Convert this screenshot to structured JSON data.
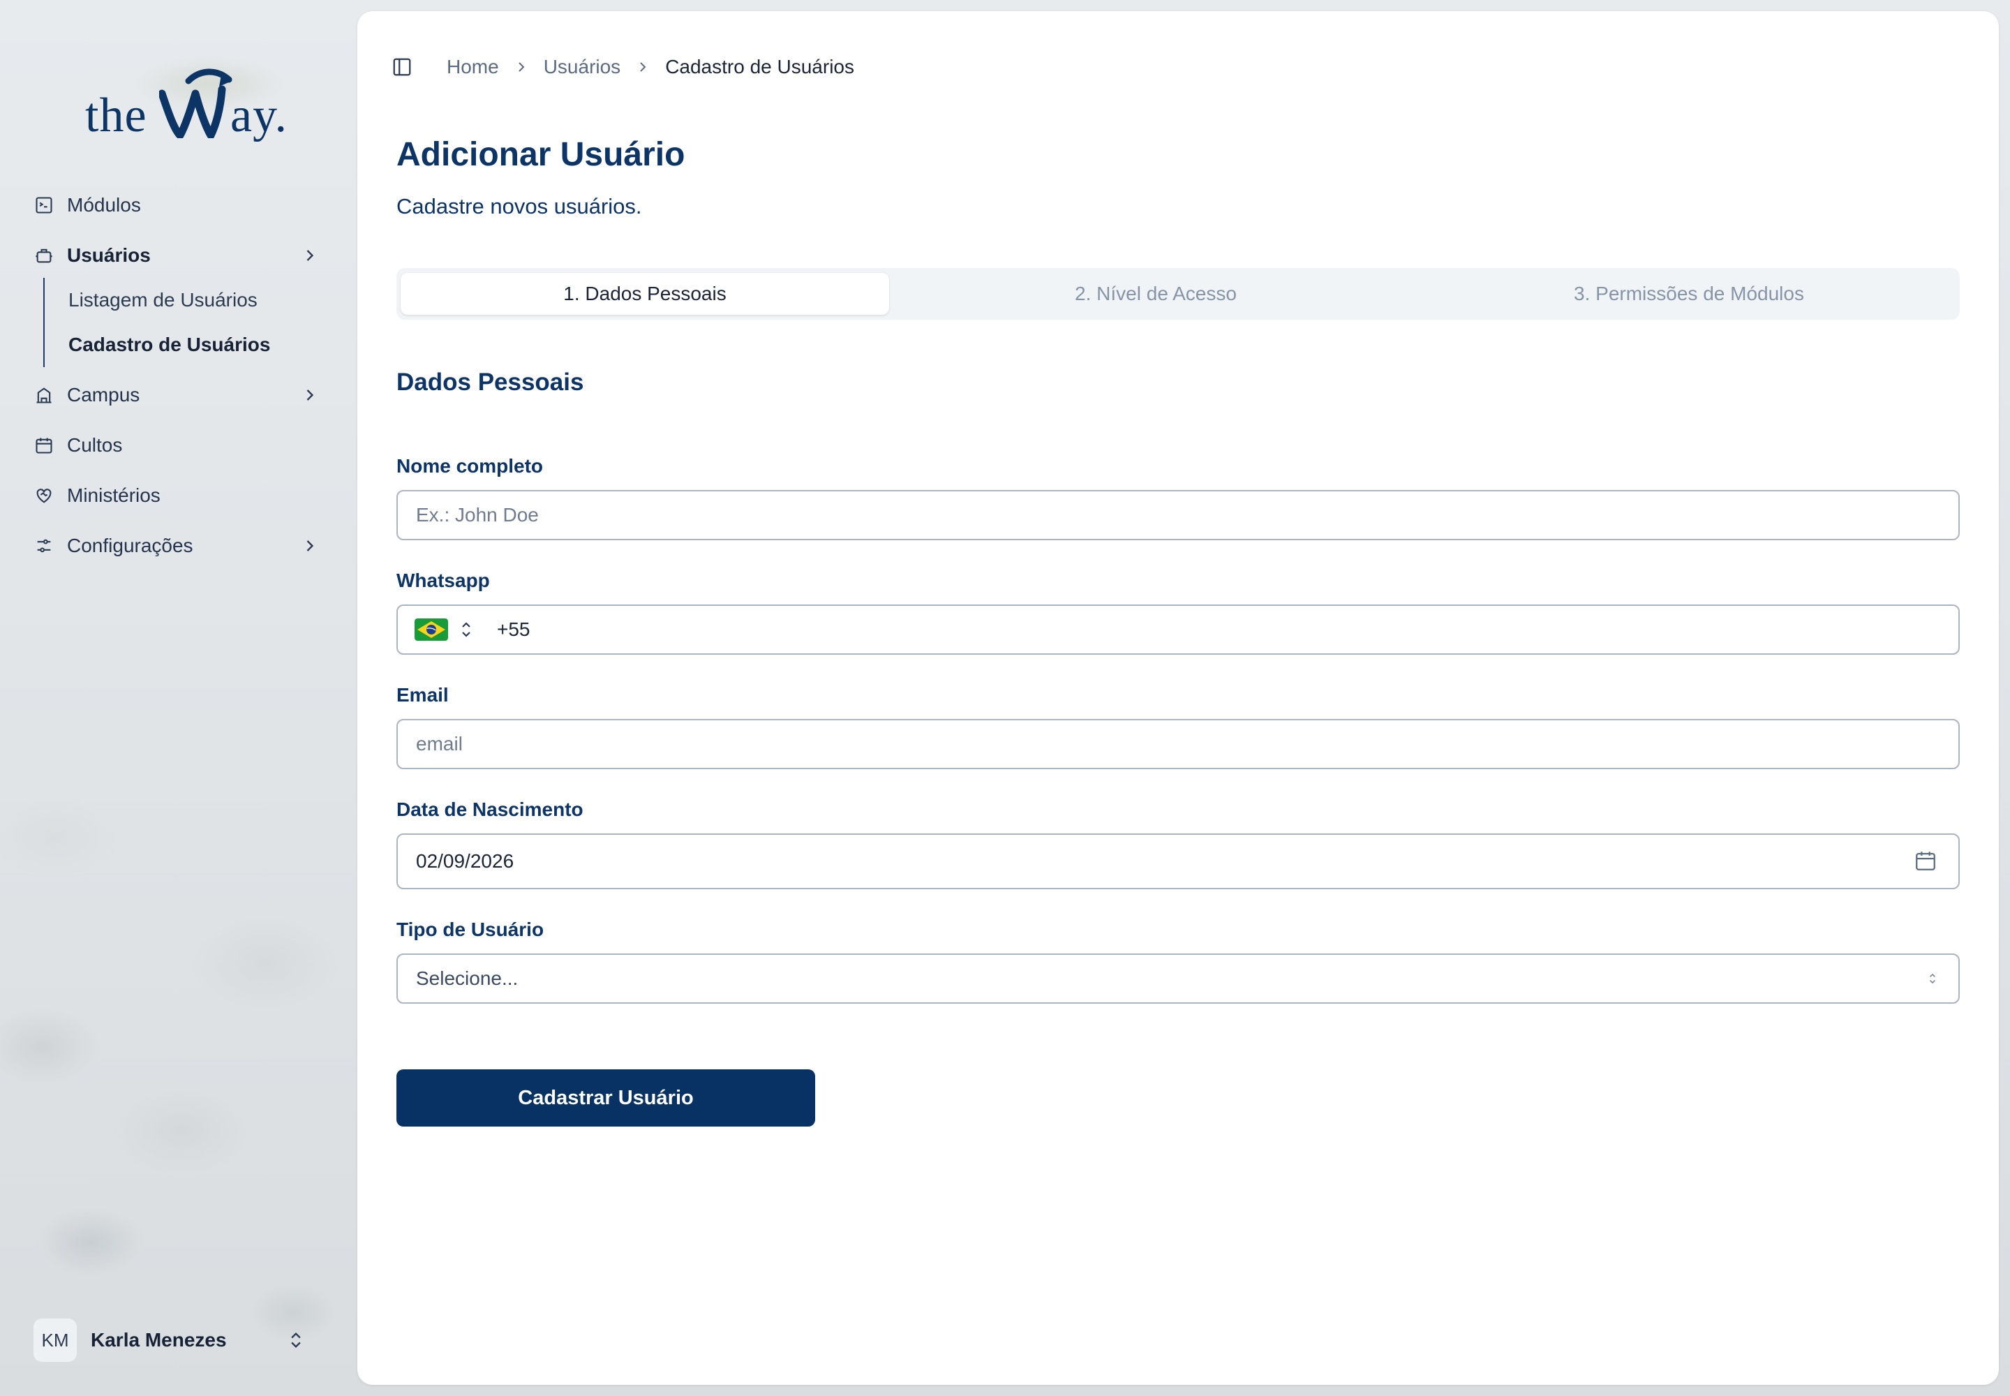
{
  "brand": {
    "logo_text_a": "the",
    "logo_text_b": "ay."
  },
  "sidebar": {
    "items": [
      {
        "label": "Módulos",
        "icon": "modules-icon"
      },
      {
        "label": "Usuários",
        "icon": "users-icon",
        "active": true,
        "sub": [
          {
            "label": "Listagem de Usuários"
          },
          {
            "label": "Cadastro de Usuários",
            "active": true
          }
        ]
      },
      {
        "label": "Campus",
        "icon": "campus-icon"
      },
      {
        "label": "Cultos",
        "icon": "calendar-icon"
      },
      {
        "label": "Ministérios",
        "icon": "heart-handshake-icon"
      },
      {
        "label": "Configurações",
        "icon": "settings-sliders-icon"
      }
    ],
    "user": {
      "initials": "KM",
      "name": "Karla Menezes"
    }
  },
  "breadcrumb": {
    "home": "Home",
    "section": "Usuários",
    "current": "Cadastro de Usuários"
  },
  "page": {
    "title": "Adicionar Usuário",
    "subtitle": "Cadastre novos usuários."
  },
  "tabs": [
    {
      "label": "1. Dados Pessoais",
      "active": true
    },
    {
      "label": "2. Nível de Acesso"
    },
    {
      "label": "3. Permissões de Módulos"
    }
  ],
  "form": {
    "section_title": "Dados Pessoais",
    "name": {
      "label": "Nome completo",
      "placeholder": "Ex.: John Doe",
      "value": ""
    },
    "whatsapp": {
      "label": "Whatsapp",
      "country": "Brasil",
      "value": "+55"
    },
    "email": {
      "label": "Email",
      "placeholder": "email",
      "value": ""
    },
    "birthdate": {
      "label": "Data de Nascimento",
      "value": "02/09/2026"
    },
    "user_type": {
      "label": "Tipo de Usuário",
      "selected": "Selecione..."
    },
    "submit_label": "Cadastrar Usuário"
  },
  "colors": {
    "brand_navy": "#083264",
    "heading": "#0d3466",
    "border": "#aab4c2"
  }
}
